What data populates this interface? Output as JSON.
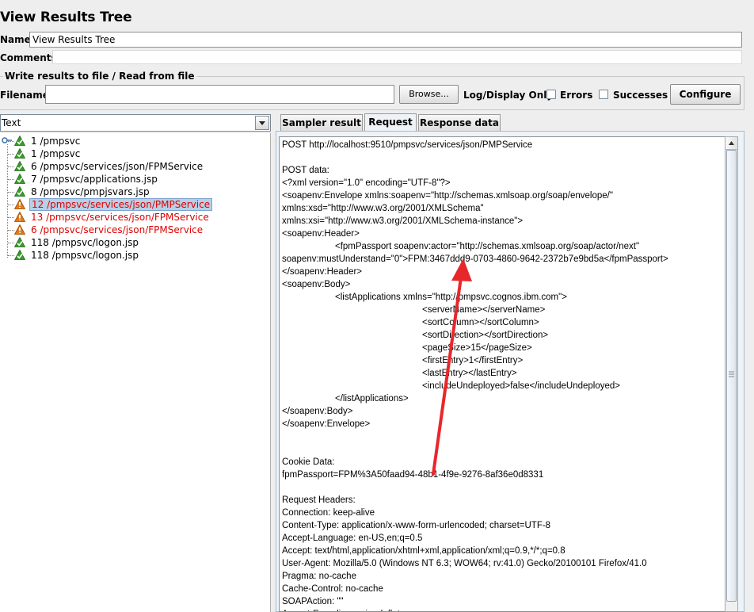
{
  "window": {
    "title": "View Results Tree"
  },
  "form": {
    "name_label": "Name:",
    "name_value": "View Results Tree",
    "comments_label": "Comments:",
    "comments_value": ""
  },
  "file_group": {
    "title": "Write results to file / Read from file",
    "filename_label": "Filename",
    "filename_value": "",
    "browse_label": "Browse...",
    "log_display_label": "Log/Display Only:",
    "errors_label": "Errors",
    "successes_label": "Successes",
    "configure_label": "Configure"
  },
  "renderer": {
    "selected": "Text"
  },
  "tree": {
    "items": [
      {
        "label": "1 /pmpsvc",
        "status": "success"
      },
      {
        "label": "1 /pmpsvc",
        "status": "success"
      },
      {
        "label": "6 /pmpsvc/services/json/FPMService",
        "status": "success"
      },
      {
        "label": "7 /pmpsvc/applications.jsp",
        "status": "success"
      },
      {
        "label": "8 /pmpsvc/pmpjsvars.jsp",
        "status": "success"
      },
      {
        "label": "12 /pmpsvc/services/json/PMPService",
        "status": "error",
        "selected": true
      },
      {
        "label": "13 /pmpsvc/services/json/FPMService",
        "status": "error"
      },
      {
        "label": "6 /pmpsvc/services/json/FPMService",
        "status": "error"
      },
      {
        "label": "118 /pmpsvc/logon.jsp",
        "status": "success"
      },
      {
        "label": "118 /pmpsvc/logon.jsp",
        "status": "success"
      }
    ]
  },
  "tabs": [
    {
      "label": "Sampler result",
      "active": false
    },
    {
      "label": "Request",
      "active": true
    },
    {
      "label": "Response data",
      "active": false
    }
  ],
  "request": {
    "lines": [
      {
        "text": "POST http://localhost:9510/pmpsvc/services/json/PMPService",
        "indent": 0
      },
      {
        "text": "",
        "indent": 0
      },
      {
        "text": "POST data:",
        "indent": 0
      },
      {
        "text": "<?xml version=\"1.0\" encoding=\"UTF-8\"?>",
        "indent": 0
      },
      {
        "text": "<soapenv:Envelope xmlns:soapenv=\"http://schemas.xmlsoap.org/soap/envelope/\"",
        "indent": 0
      },
      {
        "text": "xmlns:xsd=\"http://www.w3.org/2001/XMLSchema\"",
        "indent": 0
      },
      {
        "text": "xmlns:xsi=\"http://www.w3.org/2001/XMLSchema-instance\">",
        "indent": 0
      },
      {
        "text": "<soapenv:Header>",
        "indent": 0
      },
      {
        "text": "<fpmPassport soapenv:actor=\"http://schemas.xmlsoap.org/soap/actor/next\"",
        "indent": 1
      },
      {
        "text": "soapenv:mustUnderstand=\"0\">FPM:3467ddd9-0703-4860-9642-2372b7e9bd5a</fpmPassport>",
        "indent": 0
      },
      {
        "text": "</soapenv:Header>",
        "indent": 0
      },
      {
        "text": "<soapenv:Body>",
        "indent": 0
      },
      {
        "text": "<listApplications xmlns=\"http://pmpsvc.cognos.ibm.com\">",
        "indent": 1
      },
      {
        "text": "<serverName></serverName>",
        "indent": 2
      },
      {
        "text": "<sortColumn></sortColumn>",
        "indent": 2
      },
      {
        "text": "<sortDirection></sortDirection>",
        "indent": 2
      },
      {
        "text": "<pageSize>15</pageSize>",
        "indent": 2
      },
      {
        "text": "<firstEntry>1</firstEntry>",
        "indent": 2
      },
      {
        "text": "<lastEntry></lastEntry>",
        "indent": 2
      },
      {
        "text": "<includeUndeployed>false</includeUndeployed>",
        "indent": 2
      },
      {
        "text": "</listApplications>",
        "indent": 1
      },
      {
        "text": "</soapenv:Body>",
        "indent": 0
      },
      {
        "text": "</soapenv:Envelope>",
        "indent": 0
      },
      {
        "text": "",
        "indent": 0
      },
      {
        "text": "",
        "indent": 0
      },
      {
        "text": "Cookie Data:",
        "indent": 0
      },
      {
        "text": "fpmPassport=FPM%3A50faad94-48b1-4f9e-9276-8af36e0d8331",
        "indent": 0
      },
      {
        "text": "",
        "indent": 0
      },
      {
        "text": "Request Headers:",
        "indent": 0
      },
      {
        "text": "Connection: keep-alive",
        "indent": 0
      },
      {
        "text": "Content-Type: application/x-www-form-urlencoded; charset=UTF-8",
        "indent": 0
      },
      {
        "text": "Accept-Language: en-US,en;q=0.5",
        "indent": 0
      },
      {
        "text": "Accept: text/html,application/xhtml+xml,application/xml;q=0.9,*/*;q=0.8",
        "indent": 0
      },
      {
        "text": "User-Agent: Mozilla/5.0 (Windows NT 6.3; WOW64; rv:41.0) Gecko/20100101 Firefox/41.0",
        "indent": 0
      },
      {
        "text": "Pragma: no-cache",
        "indent": 0
      },
      {
        "text": "Cache-Control: no-cache",
        "indent": 0
      },
      {
        "text": "SOAPAction: \"\"",
        "indent": 0
      },
      {
        "text": "Accept-Encoding: gzip, deflate",
        "indent": 0
      }
    ]
  },
  "annotation": {
    "color": "#e8272b",
    "icon": "red-arrow-annotation-icon"
  },
  "colors": {
    "error_text": "#e00000",
    "selection": "#b8cfe5",
    "success_icon": "#3c9a2f",
    "error_icon": "#e07a1a"
  }
}
